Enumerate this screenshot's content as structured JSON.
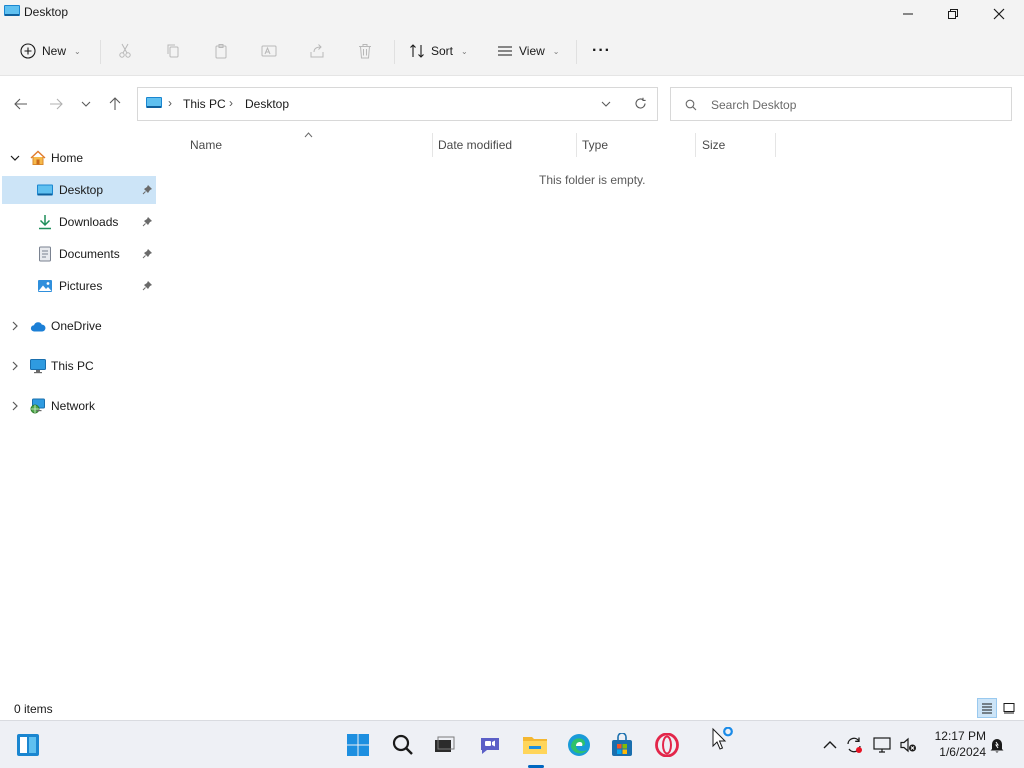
{
  "window": {
    "title": "Desktop"
  },
  "command_bar": {
    "new_label": "New",
    "sort_label": "Sort",
    "view_label": "View",
    "more_label": "···"
  },
  "address": {
    "crumbs": [
      "This PC",
      "Desktop"
    ],
    "search_placeholder": "Search Desktop"
  },
  "sidebar": {
    "items": [
      {
        "label": "Home",
        "icon": "home-icon"
      },
      {
        "label": "Desktop",
        "icon": "desktop-icon",
        "selected": true,
        "pinned": true
      },
      {
        "label": "Downloads",
        "icon": "download-icon",
        "pinned": true
      },
      {
        "label": "Documents",
        "icon": "document-icon",
        "pinned": true
      },
      {
        "label": "Pictures",
        "icon": "pictures-icon",
        "pinned": true
      },
      {
        "label": "OneDrive",
        "icon": "cloud-icon"
      },
      {
        "label": "This PC",
        "icon": "monitor-icon"
      },
      {
        "label": "Network",
        "icon": "network-icon"
      }
    ]
  },
  "content": {
    "columns": [
      "Name",
      "Date modified",
      "Type",
      "Size"
    ],
    "empty_message": "This folder is empty."
  },
  "status": {
    "item_count": "0 items"
  },
  "taskbar": {
    "time": "12:17 PM",
    "date": "1/6/2024"
  },
  "colors": {
    "accent": "#0067c0",
    "selection": "#cce4f7",
    "chrome": "#f3f3f3"
  }
}
